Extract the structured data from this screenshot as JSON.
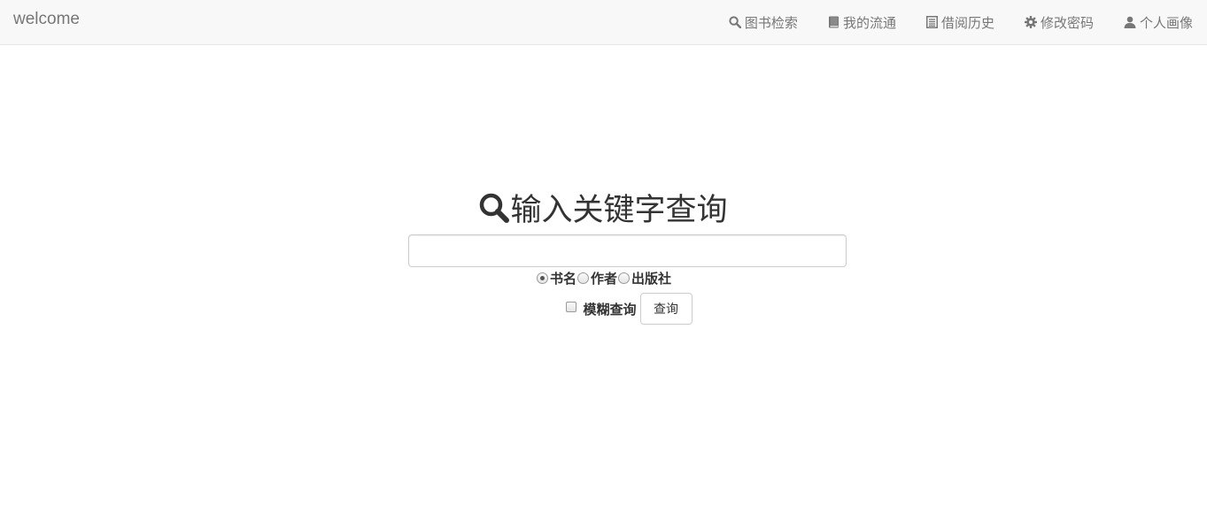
{
  "navbar": {
    "brand": "welcome",
    "items": [
      {
        "label": "图书检索",
        "icon": "search-icon"
      },
      {
        "label": "我的流通",
        "icon": "book-icon"
      },
      {
        "label": "借阅历史",
        "icon": "list-icon"
      },
      {
        "label": "修改密码",
        "icon": "gear-icon"
      },
      {
        "label": "个人画像",
        "icon": "user-icon"
      }
    ]
  },
  "search": {
    "heading": "输入关键字查询",
    "heading_icon": "search-icon",
    "input_value": "",
    "radio_options": [
      {
        "label": "书名",
        "checked": true
      },
      {
        "label": "作者",
        "checked": false
      },
      {
        "label": "出版社",
        "checked": false
      }
    ],
    "fuzzy_label": "模糊查询",
    "fuzzy_checked": false,
    "submit_label": "查询"
  },
  "colors": {
    "navbar_bg": "#f8f8f8",
    "nav_text": "#777777",
    "heading_text": "#333333"
  }
}
